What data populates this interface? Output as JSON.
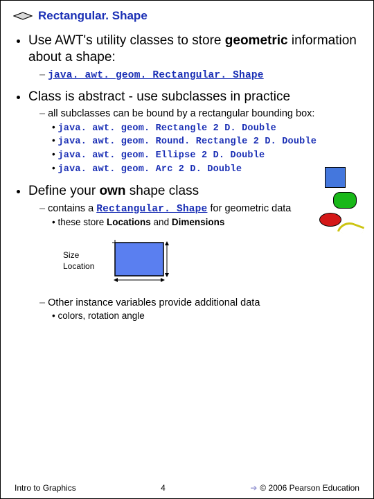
{
  "title": "Rectangular. Shape",
  "bullets": {
    "b1": "Use AWT's utility classes to store ",
    "b1_bold": "geometric",
    "b1_cont": " information about a shape:",
    "b1_code": "java. awt. geom. Rectangular. Shape",
    "b2": "Class is abstract - use subclasses in practice",
    "b2_sub": "all subclasses can be bound by a rectangular bounding box:",
    "b2_c1": "java. awt. geom. Rectangle 2 D. Double",
    "b2_c2": "java. awt. geom. Round. Rectangle 2 D. Double",
    "b2_c3": "java. awt. geom. Ellipse 2 D. Double",
    "b2_c4": "java. awt. geom. Arc 2 D. Double",
    "b3a": "Define your ",
    "b3b": "own",
    "b3c": " shape class",
    "b3_sub_a": "contains a ",
    "b3_sub_code": "Rectangular. Shape",
    "b3_sub_b": " for geometric data",
    "b3_dot_a": "these store ",
    "b3_dot_b": "Locations",
    "b3_dot_c": " and ",
    "b3_dot_d": "Dimensions",
    "b3_sub2": "Other instance variables provide additional data",
    "b3_dot2": "colors, rotation angle"
  },
  "diagram": {
    "l1": "Size",
    "l2": "Location"
  },
  "footer": {
    "left": "Intro to Graphics",
    "page": "4",
    "right": "© 2006 Pearson Education"
  }
}
